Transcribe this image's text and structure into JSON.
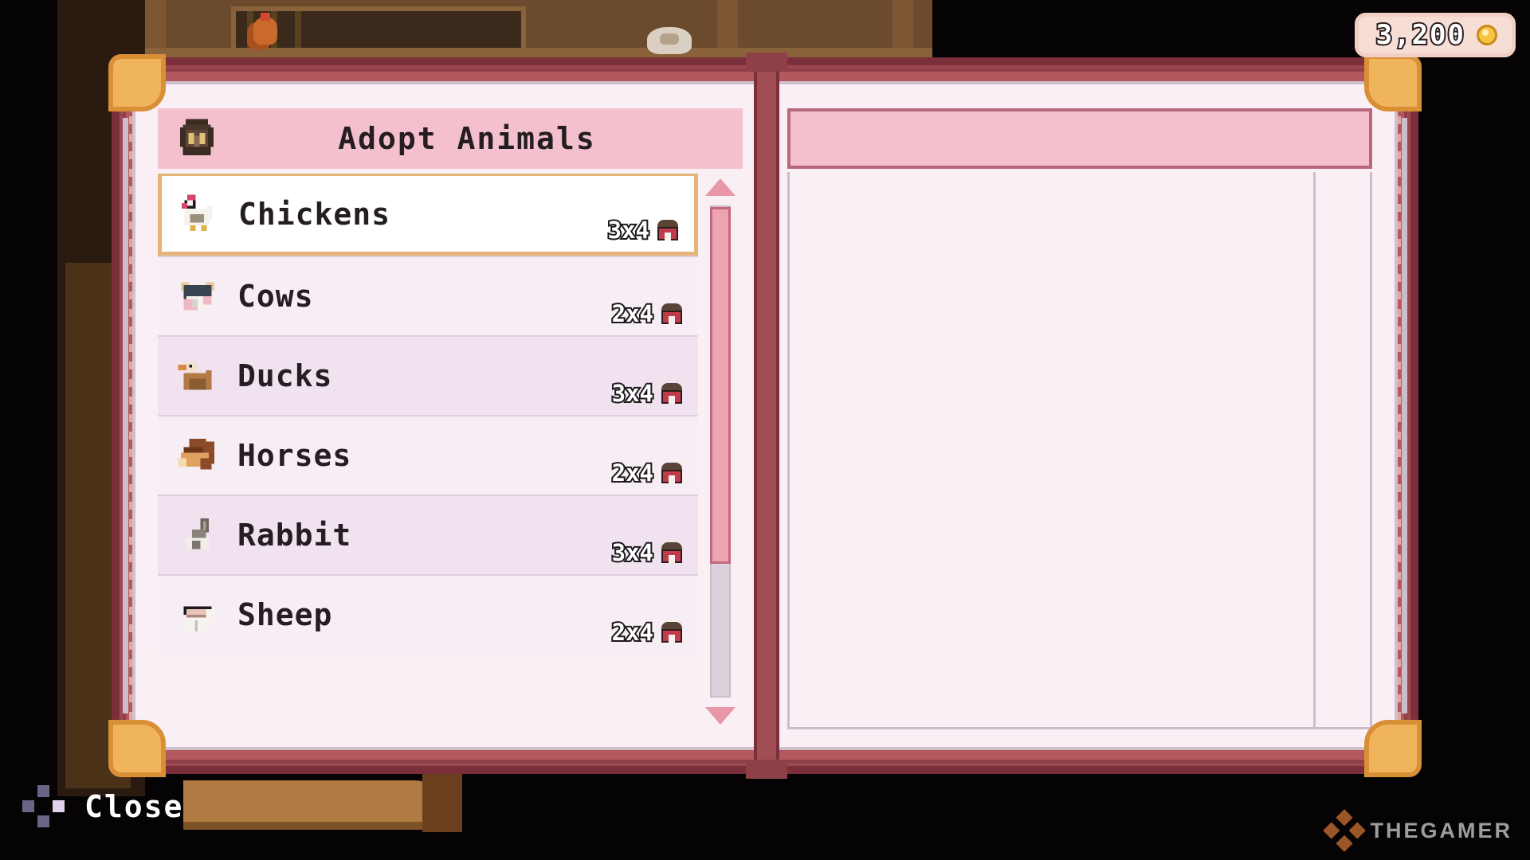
{
  "scene": {
    "background_color": "#000000",
    "description": "farm shop interior behind menu"
  },
  "currency": {
    "amount": "3,200",
    "icon": "coin-icon"
  },
  "book": {
    "frame_color": "#9c4a50",
    "page_color": "#fbeff6",
    "corner_color": "#f0b45c"
  },
  "panel": {
    "title": "Adopt Animals",
    "avatar_icon": "shopkeeper-avatar-icon",
    "header_color": "#f4c0cd"
  },
  "animals": [
    {
      "name": "Chickens",
      "icon": "chicken-icon",
      "requirement": "3x4",
      "building_icon": "barn-icon",
      "selected": true
    },
    {
      "name": "Cows",
      "icon": "cow-icon",
      "requirement": "2x4",
      "building_icon": "barn-icon",
      "selected": false
    },
    {
      "name": "Ducks",
      "icon": "duck-icon",
      "requirement": "3x4",
      "building_icon": "barn-icon",
      "selected": false
    },
    {
      "name": "Horses",
      "icon": "horse-icon",
      "requirement": "2x4",
      "building_icon": "barn-icon",
      "selected": false
    },
    {
      "name": "Rabbit",
      "icon": "rabbit-icon",
      "requirement": "3x4",
      "building_icon": "barn-icon",
      "selected": false
    },
    {
      "name": "Sheep",
      "icon": "sheep-icon",
      "requirement": "2x4",
      "building_icon": "barn-icon",
      "selected": false
    }
  ],
  "scrollbar": {
    "up_arrow": "scroll-up-arrow-icon",
    "down_arrow": "scroll-down-arrow-icon",
    "thumb_fraction": 0.73,
    "thumb_color": "#eda4b2"
  },
  "detail_panel": {
    "header_text": "",
    "body_text": ""
  },
  "close_button": {
    "label": "Close",
    "icon": "dpad-icon"
  },
  "watermark": {
    "text": "THEGAMER",
    "icon": "thegamer-logo-icon"
  }
}
